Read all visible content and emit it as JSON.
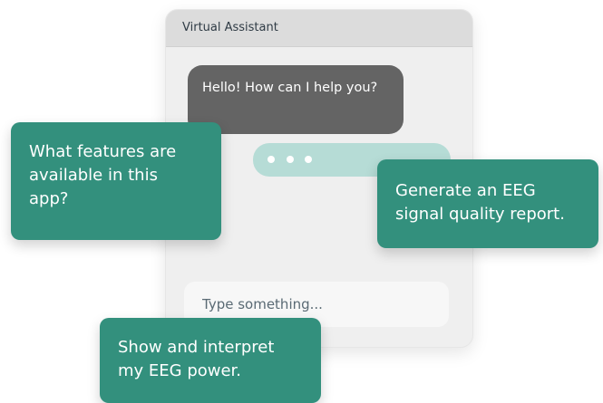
{
  "chat": {
    "title": "Virtual Assistant",
    "assistant_message": "Hello! How can I help you?",
    "input_placeholder": "Type something..."
  },
  "cards": [
    {
      "text": "What features are\navailable in this\napp?"
    },
    {
      "text": "Generate an EEG\nsignal quality report."
    },
    {
      "text": "Show and interpret\nmy EEG power."
    }
  ],
  "colors": {
    "card_teal": "#33907d",
    "assistant_bubble": "#646464",
    "typing_bubble": "#b6dcd6",
    "header": "#dcdcdc"
  }
}
